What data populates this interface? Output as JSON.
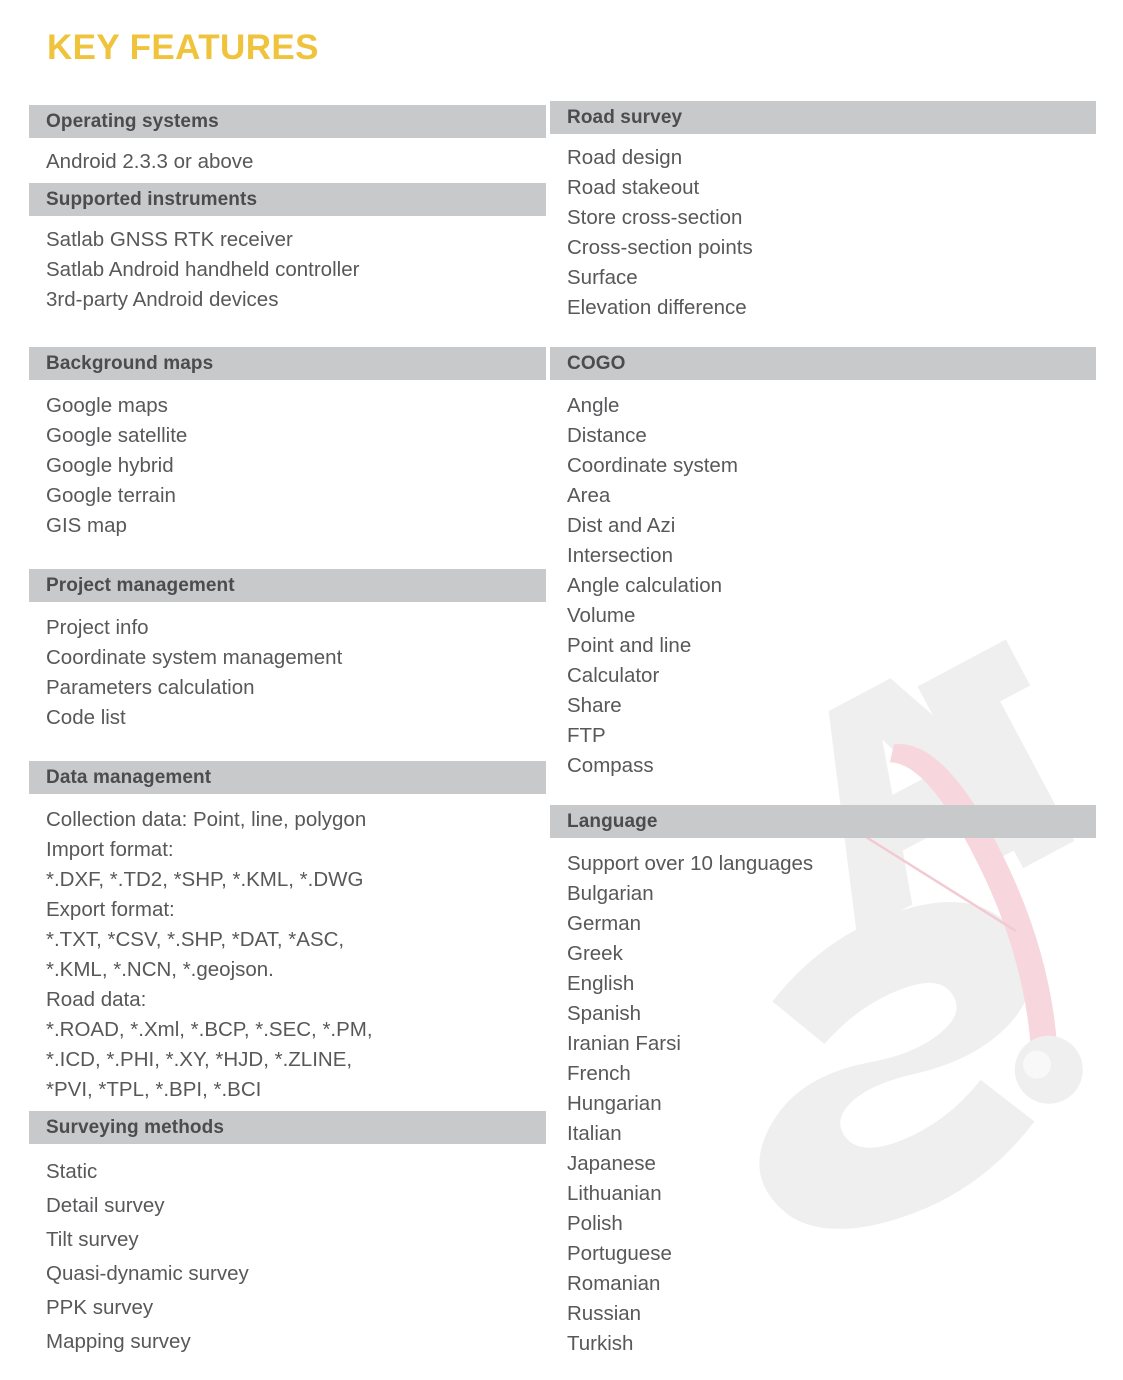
{
  "document": {
    "title": "KEY FEATURES",
    "title_color": "#f0c33c",
    "bar_color": "#c8c9ca",
    "text_color": "#58585a",
    "watermark_text": "SAT"
  },
  "left_column": [
    {
      "heading": "Operating systems",
      "items": [
        "Android 2.3.3 or above"
      ]
    },
    {
      "heading": "Supported instruments",
      "items": [
        "Satlab GNSS RTK receiver",
        "Satlab Android handheld controller",
        "3rd-party Android devices"
      ]
    },
    {
      "heading": "Background maps",
      "items": [
        "Google maps",
        "Google satellite",
        "Google hybrid",
        "Google terrain",
        "GIS map"
      ]
    },
    {
      "heading": "Project management",
      "items": [
        "Project info",
        "Coordinate system management",
        "Parameters calculation",
        "Code list"
      ]
    },
    {
      "heading": "Data management",
      "items": [
        "Collection data: Point, line, polygon",
        "Import format:",
        "*.DXF, *.TD2, *SHP, *.KML, *.DWG",
        "Export format:",
        "*.TXT, *CSV, *.SHP, *DAT, *ASC,",
        "*.KML, *.NCN, *.geojson.",
        "Road data:",
        "*.ROAD, *.Xml, *.BCP, *.SEC, *.PM,",
        "*.ICD, *.PHI, *.XY, *HJD, *.ZLINE,",
        "*PVI, *TPL, *.BPI, *.BCI"
      ]
    },
    {
      "heading": "Surveying methods",
      "items": [
        "Static",
        "Detail survey",
        "Tilt survey",
        "Quasi-dynamic survey",
        "PPK survey",
        "Mapping survey"
      ]
    }
  ],
  "right_column": [
    {
      "heading": "Road survey",
      "items": [
        "Road design",
        "Road stakeout",
        "Store cross-section",
        "Cross-section points",
        "Surface",
        "Elevation difference"
      ]
    },
    {
      "heading": "COGO",
      "items": [
        "Angle",
        "Distance",
        "Coordinate system",
        "Area",
        "Dist and Azi",
        "Intersection",
        "Angle calculation",
        "Volume",
        "Point and line",
        "Calculator",
        "Share",
        "FTP",
        "Compass"
      ]
    },
    {
      "heading": "Language",
      "items": [
        "Support over 10 languages",
        "Bulgarian",
        "German",
        "Greek",
        "English",
        "Spanish",
        "Iranian Farsi",
        "French",
        "Hungarian",
        "Italian",
        "Japanese",
        "Lithuanian",
        "Polish",
        "Portuguese",
        "Romanian",
        "Russian",
        "Turkish"
      ]
    }
  ]
}
